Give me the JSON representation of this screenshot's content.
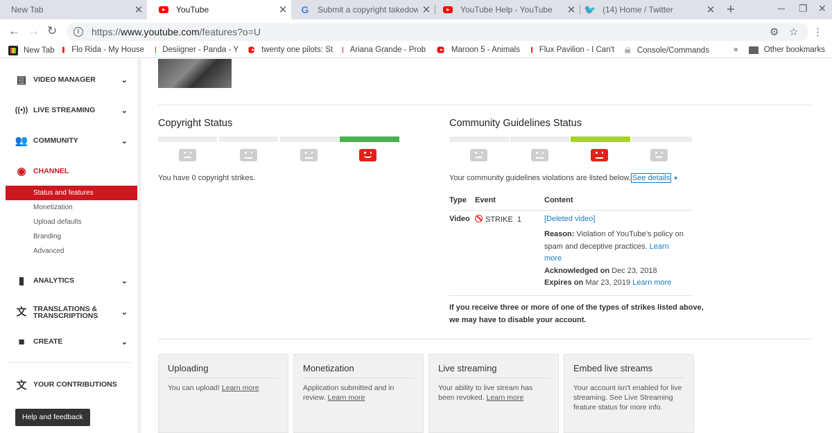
{
  "browser": {
    "tabs": [
      {
        "title": "New Tab",
        "icon": "none"
      },
      {
        "title": "YouTube",
        "icon": "youtube-icon",
        "active": true
      },
      {
        "title": "Submit a copyright takedown n",
        "icon": "google-icon"
      },
      {
        "title": "YouTube Help - YouTube",
        "icon": "youtube-icon"
      },
      {
        "title": "(14) Home / Twitter",
        "icon": "twitter-icon"
      }
    ],
    "url": {
      "scheme": "https://",
      "host": "www.youtube.com",
      "path": "/features?o=U"
    },
    "bookmarks": [
      {
        "label": "New Tab"
      },
      {
        "label": "Flo Rida - My House"
      },
      {
        "label": "Desiigner - Panda - Y"
      },
      {
        "label": "twenty one pilots: St"
      },
      {
        "label": "Ariana Grande - Prob"
      },
      {
        "label": "Maroon 5 - Animals"
      },
      {
        "label": "Flux Pavilion - I Can't"
      },
      {
        "label": "Console/Commands"
      },
      {
        "label": "Other bookmarks"
      }
    ]
  },
  "sidebar": {
    "items": [
      {
        "label": "VIDEO MANAGER",
        "icon": "video-manager-icon"
      },
      {
        "label": "LIVE STREAMING",
        "icon": "live-streaming-icon"
      },
      {
        "label": "COMMUNITY",
        "icon": "community-icon"
      },
      {
        "label": "CHANNEL",
        "icon": "channel-icon"
      },
      {
        "label": "ANALYTICS",
        "icon": "analytics-icon"
      },
      {
        "label": "TRANSLATIONS &",
        "label2": "TRANSCRIPTIONS",
        "icon": "translate-icon"
      },
      {
        "label": "CREATE",
        "icon": "create-icon"
      },
      {
        "label": "YOUR CONTRIBUTIONS",
        "icon": "contributions-icon"
      }
    ],
    "channel_subitems": [
      "Status and features",
      "Monetization",
      "Upload defaults",
      "Branding",
      "Advanced"
    ],
    "help_button": "Help and feedback"
  },
  "copyright": {
    "title": "Copyright Status",
    "strikes_text": "You have 0 copyright strikes.",
    "colors": {
      "active": "#4caf50"
    }
  },
  "community": {
    "title": "Community Guidelines Status",
    "intro": "Your community guidelines violations are listed below.",
    "see_details": "See details",
    "table": {
      "headers": [
        "Type",
        "Event",
        "Content"
      ],
      "row": {
        "type": "Video",
        "event": "STRIKE",
        "count": "1",
        "content_link": "[Deleted video]",
        "reason_label": "Reason:",
        "reason_text1": "Violation of YouTube's policy on",
        "reason_text2": "spam and deceptive practices.",
        "learn_more_1": "Learn",
        "learn_more_2": "more",
        "ack_label": "Acknowledged on",
        "ack_date": "Dec 23, 2018",
        "exp_label": "Expires on",
        "exp_date": "Mar 23, 2019",
        "learn_more": "Learn more"
      }
    },
    "warning1": "If you receive three or more of one of the types of strikes listed above,",
    "warning2": "we may have to disable your account.",
    "colors": {
      "active": "#a4d617"
    }
  },
  "features": [
    {
      "title": "Uploading",
      "body": "You can upload!",
      "link": "Learn more"
    },
    {
      "title": "Monetization",
      "body": "Application submitted and in review.",
      "link": "Learn more"
    },
    {
      "title": "Live streaming",
      "body": "Your ability to live stream has been revoked.",
      "link": "Learn more"
    },
    {
      "title": "Embed live streams",
      "body": "Your account isn't enabled for live streaming. See Live Streaming feature status for more info.",
      "link": ""
    }
  ]
}
